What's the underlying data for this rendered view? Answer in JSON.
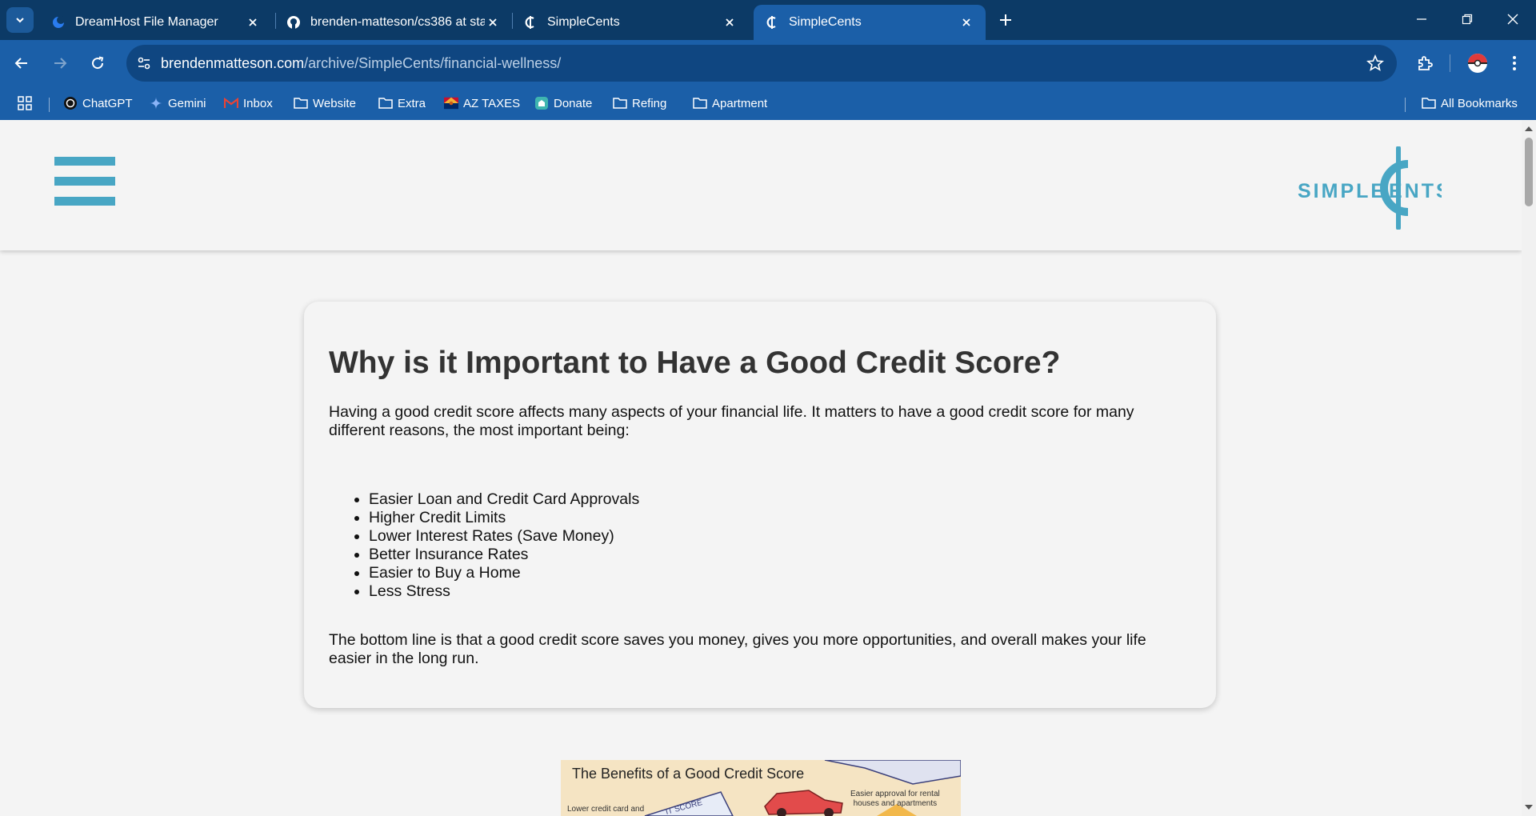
{
  "browser": {
    "tabs": [
      {
        "title": "DreamHost File Manager",
        "icon": "dreamhost-icon",
        "active": false
      },
      {
        "title": "brenden-matteson/cs386 at sta",
        "icon": "github-icon",
        "active": false
      },
      {
        "title": "SimpleCents",
        "icon": "simplecents-icon",
        "active": false
      },
      {
        "title": "SimpleCents",
        "icon": "simplecents-icon",
        "active": true
      }
    ],
    "url_host": "brendenmatteson.com",
    "url_path": "/archive/SimpleCents/financial-wellness/",
    "bookmarks": [
      {
        "label": "ChatGPT",
        "icon": "chatgpt-icon"
      },
      {
        "label": "Gemini",
        "icon": "gemini-icon"
      },
      {
        "label": "Inbox",
        "icon": "gmail-icon"
      },
      {
        "label": "Website",
        "icon": "folder-icon"
      },
      {
        "label": "Extra",
        "icon": "folder-icon"
      },
      {
        "label": "AZ TAXES",
        "icon": "az-flag-icon"
      },
      {
        "label": "Donate",
        "icon": "donate-icon"
      },
      {
        "label": "Refing",
        "icon": "folder-icon"
      },
      {
        "label": "Apartment",
        "icon": "folder-icon"
      }
    ],
    "all_bookmarks": "All Bookmarks"
  },
  "site": {
    "logo_text_left": "SIMPLE",
    "logo_text_right": "ENTS",
    "brand_color": "#48a6c4"
  },
  "article": {
    "heading": "Why is it Important to Have a Good Credit Score?",
    "intro": "Having a good credit score affects many aspects of your financial life. It matters to have a good credit score for many different reasons, the most important being:",
    "benefits": [
      "Easier Loan and Credit Card Approvals",
      "Higher Credit Limits",
      "Lower Interest Rates (Save Money)",
      "Better Insurance Rates",
      "Easier to Buy a Home",
      "Less Stress"
    ],
    "conclusion": "The bottom line is that a good credit score saves you money, gives you more opportunities, and overall makes your life easier in the long run."
  },
  "infographic": {
    "title": "The Benefits of a Good Credit Score",
    "caption_left": "Lower credit card and",
    "caption_right_1": "Easier approval for rental",
    "caption_right_2": "houses and apartments",
    "card_text": "IT SCORE"
  }
}
